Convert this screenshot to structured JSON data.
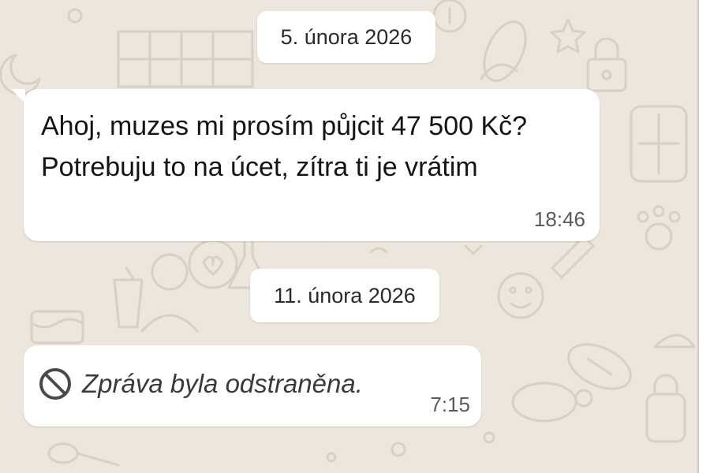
{
  "colors": {
    "wallpaper": "#ece6dc",
    "doodle": "#d8d0c2",
    "bubble": "#ffffff",
    "text": "#141414",
    "meta_text": "#5a5a5a"
  },
  "chat": {
    "day_1": {
      "date": "5. února 2026",
      "messages": [
        {
          "lines": [
            "Ahoj, muzes mi prosím půjcit 47 500 Kč?",
            "Potrebuju to na úcet, zítra ti je vrátim"
          ],
          "time": "18:46"
        }
      ]
    },
    "day_2": {
      "date": "11. února 2026",
      "messages": [
        {
          "deleted_text": "Zpráva byla odstraněna.",
          "icon": "ban-icon",
          "time": "7:15"
        }
      ]
    }
  }
}
